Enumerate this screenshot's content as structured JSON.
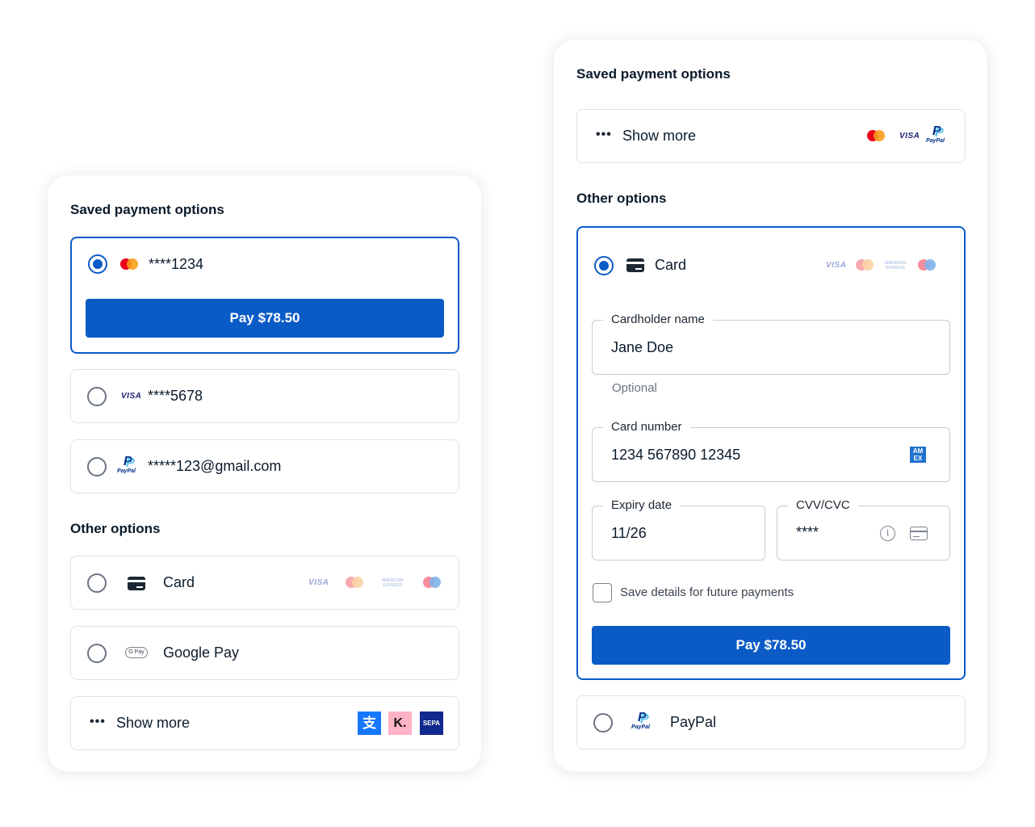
{
  "left_panel": {
    "saved_title": "Saved payment options",
    "saved_options": [
      {
        "label": "****1234",
        "brand": "mastercard",
        "selected": true,
        "pay_label": "Pay $78.50"
      },
      {
        "label": "****5678",
        "brand": "visa",
        "brand_text": "VISA",
        "selected": false
      },
      {
        "label": "*****123@gmail.com",
        "brand": "paypal",
        "brand_text": "PayPal",
        "selected": false
      }
    ],
    "other_title": "Other options",
    "other_options": [
      {
        "label": "Card",
        "icon": "card-icon",
        "brands": [
          "visa",
          "mastercard",
          "amex",
          "maestro"
        ],
        "visa_text": "VISA",
        "amex_text": "AMERICAN EXPRESS"
      },
      {
        "label": "Google Pay",
        "icon": "google-pay-icon",
        "icon_text": "G Pay"
      },
      {
        "label": "Show more",
        "icon": "more-dots-icon",
        "icon_text": "•••",
        "brands": [
          "alipay",
          "klarna",
          "sepa"
        ],
        "alipay_text": "支",
        "klarna_text": "K.",
        "sepa_text": "SEPA"
      }
    ]
  },
  "right_panel": {
    "saved_title": "Saved payment options",
    "show_more": {
      "label": "Show more",
      "dots": "•••",
      "brands": [
        "mastercard",
        "visa",
        "paypal"
      ],
      "visa_text": "VISA",
      "paypal_text": "PayPal"
    },
    "other_title": "Other options",
    "card_option": {
      "label": "Card",
      "selected": true,
      "brands": [
        "visa",
        "mastercard",
        "amex",
        "maestro"
      ],
      "visa_text": "VISA",
      "amex_text": "AMERICAN EXPRESS",
      "cardholder": {
        "legend": "Cardholder name",
        "value": "Jane Doe",
        "helper": "Optional"
      },
      "card_number": {
        "legend": "Card number",
        "value": "1234 567890 12345",
        "amex_badge": "AM EX"
      },
      "expiry": {
        "legend": "Expiry date",
        "value": "11/26"
      },
      "cvc": {
        "legend": "CVV/CVC",
        "value": "****",
        "info": "i"
      },
      "save_details": {
        "label": "Save details for future payments",
        "checked": false
      },
      "pay_label": "Pay $78.50"
    },
    "paypal_option": {
      "label": "PayPal",
      "brand_text": "PayPal",
      "selected": false
    }
  },
  "colors": {
    "primary": "#0b5bc7",
    "border": "#dfe3e8",
    "text": "#0b1b2b"
  }
}
